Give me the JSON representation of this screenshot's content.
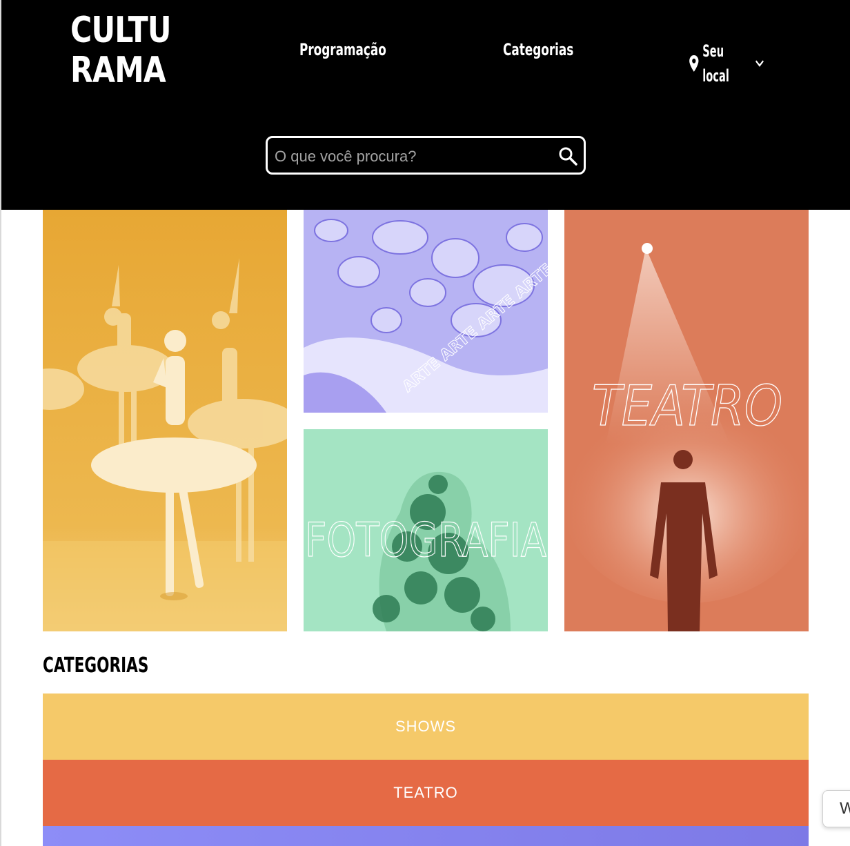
{
  "header": {
    "logo_line1": "CULTU",
    "logo_line2": "RAMA",
    "nav": {
      "programacao": "Programação",
      "categorias": "Categorias",
      "location": "Seu local"
    },
    "search": {
      "placeholder": "O que você procura?"
    }
  },
  "tiles": {
    "arte_text": "ARTE ARTE ARTE ARTE",
    "foto_text": "FOTOGRAFIA",
    "teatro_text": "TEATRO"
  },
  "categories_section": {
    "title": "CATEGORIAS",
    "items": [
      {
        "label": "SHOWS",
        "color": "#f5c969"
      },
      {
        "label": "TEATRO",
        "color": "#e56a45"
      },
      {
        "label": "",
        "color": "#8a87f2"
      }
    ]
  },
  "side_widget": {
    "label": "W"
  },
  "colors": {
    "header_bg": "#000000",
    "ballet": "#e8ad3b",
    "arte": "#b2aef2",
    "fotografia": "#a2e3c1",
    "teatro": "#dd7d5b"
  }
}
